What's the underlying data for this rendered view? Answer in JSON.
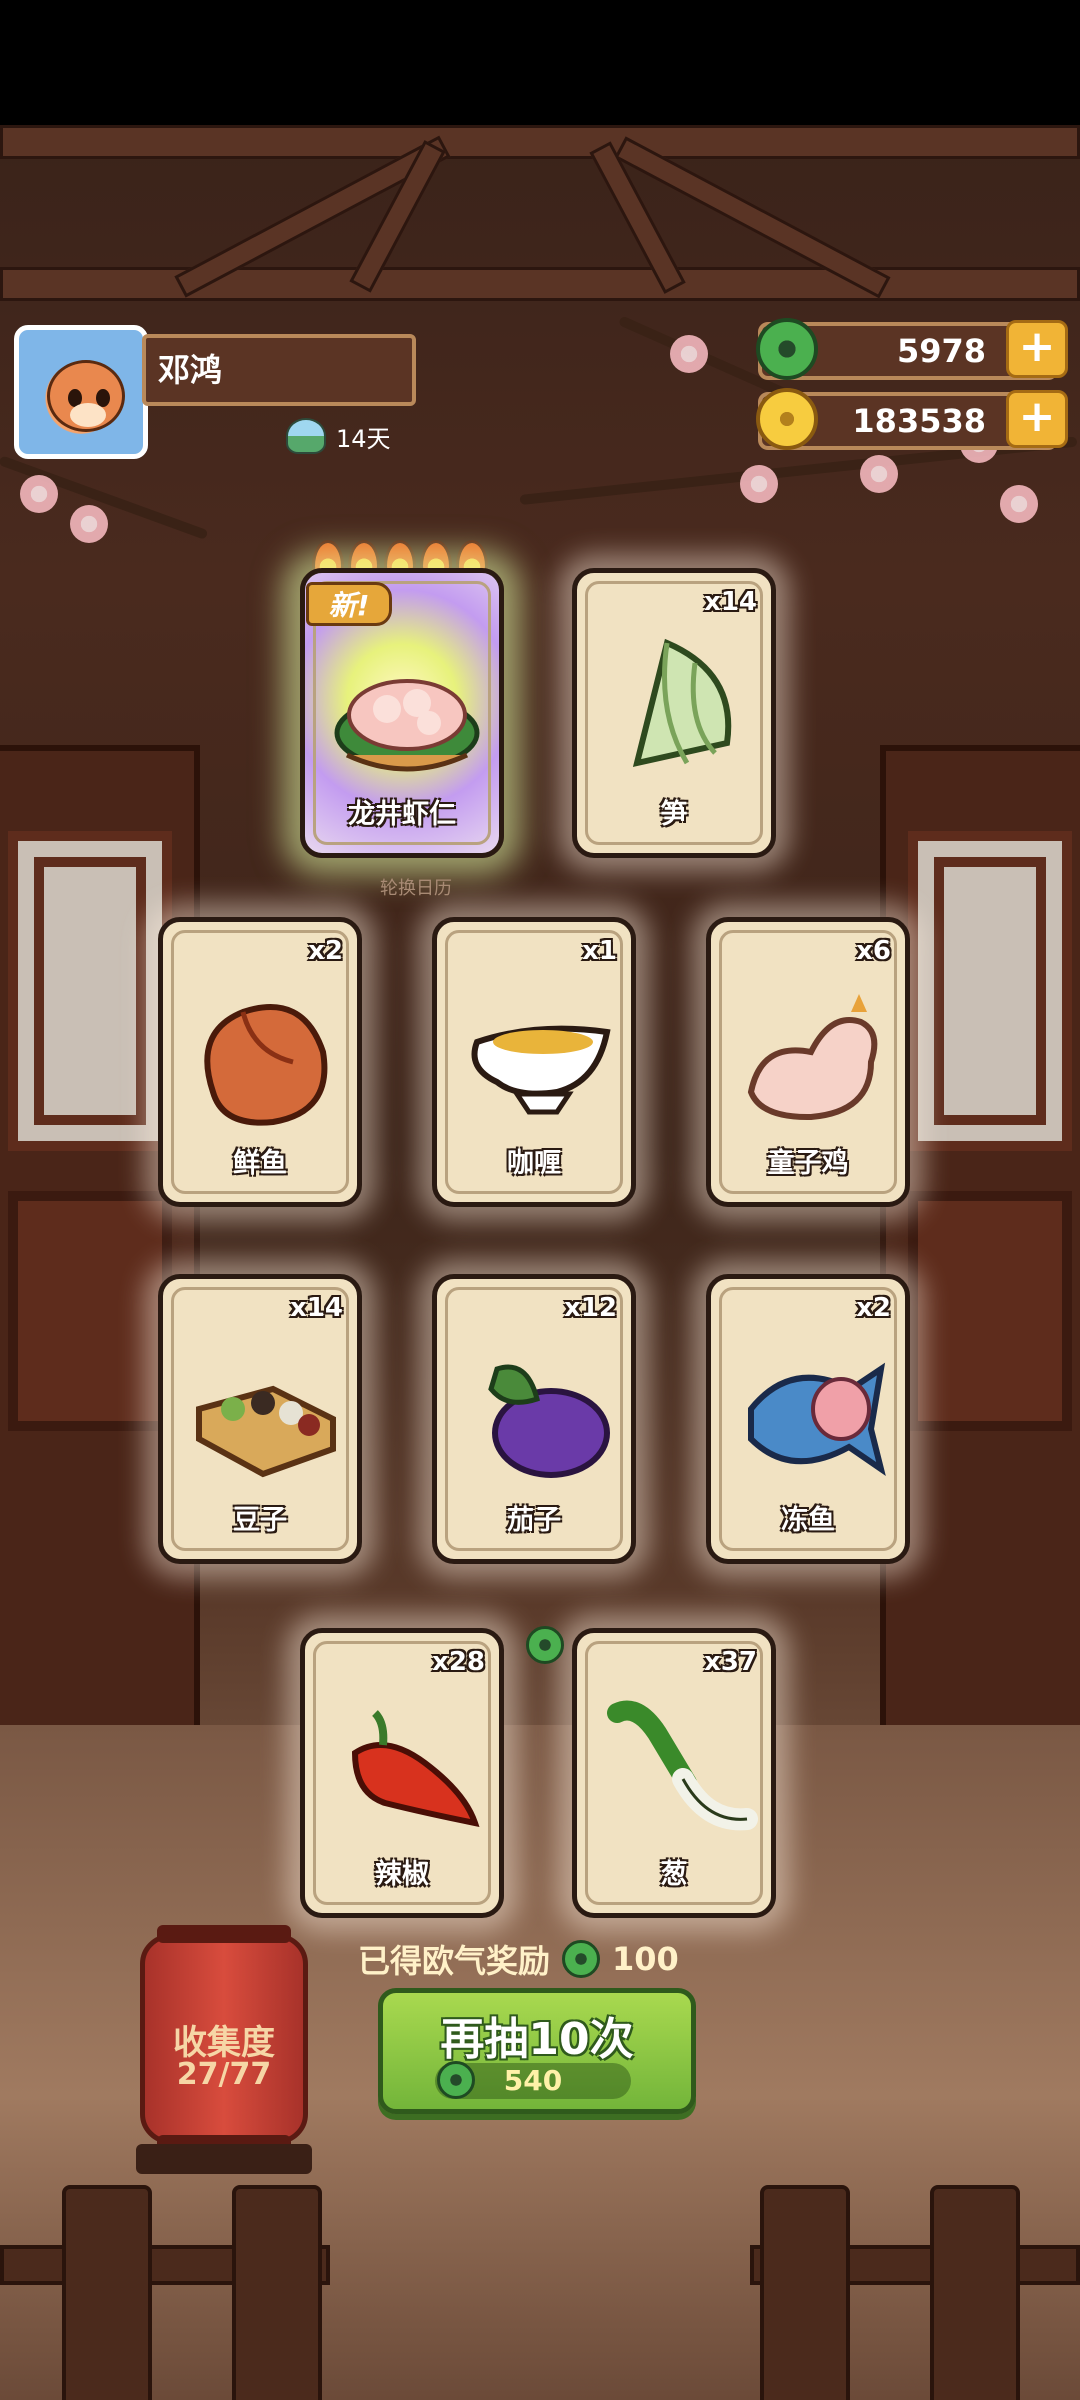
{
  "player": {
    "name": "邓鸿",
    "days": "14天"
  },
  "currency": {
    "jade": "5978",
    "coins": "183538"
  },
  "new_tag": "新!",
  "calendar_label": "轮换日历",
  "cards": [
    {
      "name": "龙井虾仁",
      "count": "",
      "icon": "shrimp-dish-icon"
    },
    {
      "name": "笋",
      "count": "x14",
      "icon": "bamboo-shoot-icon"
    },
    {
      "name": "鲜鱼",
      "count": "x2",
      "icon": "fish-icon"
    },
    {
      "name": "咖喱",
      "count": "x1",
      "icon": "curry-icon"
    },
    {
      "name": "童子鸡",
      "count": "x6",
      "icon": "chicken-icon"
    },
    {
      "name": "豆子",
      "count": "x14",
      "icon": "beans-icon"
    },
    {
      "name": "茄子",
      "count": "x12",
      "icon": "eggplant-icon"
    },
    {
      "name": "冻鱼",
      "count": "x2",
      "icon": "frozen-fish-icon"
    },
    {
      "name": "辣椒",
      "count": "x28",
      "icon": "chili-icon"
    },
    {
      "name": "葱",
      "count": "x37",
      "icon": "scallion-icon"
    }
  ],
  "collection": {
    "label": "收集度",
    "value": "27/77"
  },
  "reward": {
    "label": "已得欧气奖励",
    "value": "100"
  },
  "draw_button": {
    "label": "再抽10次",
    "cost": "540"
  },
  "colors": {
    "accent_green": "#73b53a",
    "wood": "#5b3424",
    "gold": "#f1b436",
    "card": "#f1e2c2"
  }
}
